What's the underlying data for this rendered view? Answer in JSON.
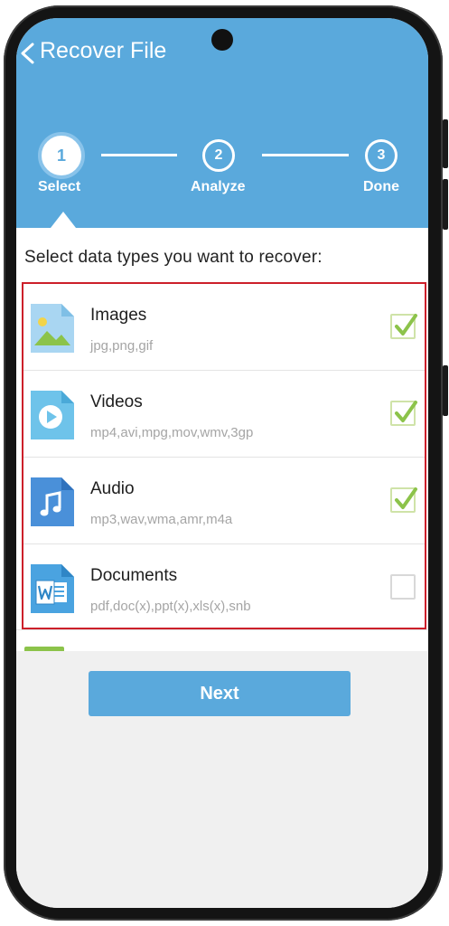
{
  "header": {
    "title": "Recover File",
    "steps": [
      {
        "number": "1",
        "label": "Select",
        "state": "active"
      },
      {
        "number": "2",
        "label": "Analyze",
        "state": "pending"
      },
      {
        "number": "3",
        "label": "Done",
        "state": "pending"
      }
    ]
  },
  "main": {
    "prompt": "Select data types you want to recover:",
    "items": [
      {
        "title": "Images",
        "formats": "jpg,png,gif",
        "icon": "image-file-icon",
        "checked": true
      },
      {
        "title": "Videos",
        "formats": "mp4,avi,mpg,mov,wmv,3gp",
        "icon": "video-file-icon",
        "checked": true
      },
      {
        "title": "Audio",
        "formats": "mp3,wav,wma,amr,m4a",
        "icon": "audio-file-icon",
        "checked": true
      },
      {
        "title": "Documents",
        "formats": "pdf,doc(x),ppt(x),xls(x),snb",
        "icon": "word-document-icon",
        "checked": false
      }
    ]
  },
  "footer": {
    "next_label": "Next"
  },
  "colors": {
    "header_blue": "#5aa9dc",
    "check_green": "#8cc34a",
    "highlight_red": "#cc1f2a"
  }
}
